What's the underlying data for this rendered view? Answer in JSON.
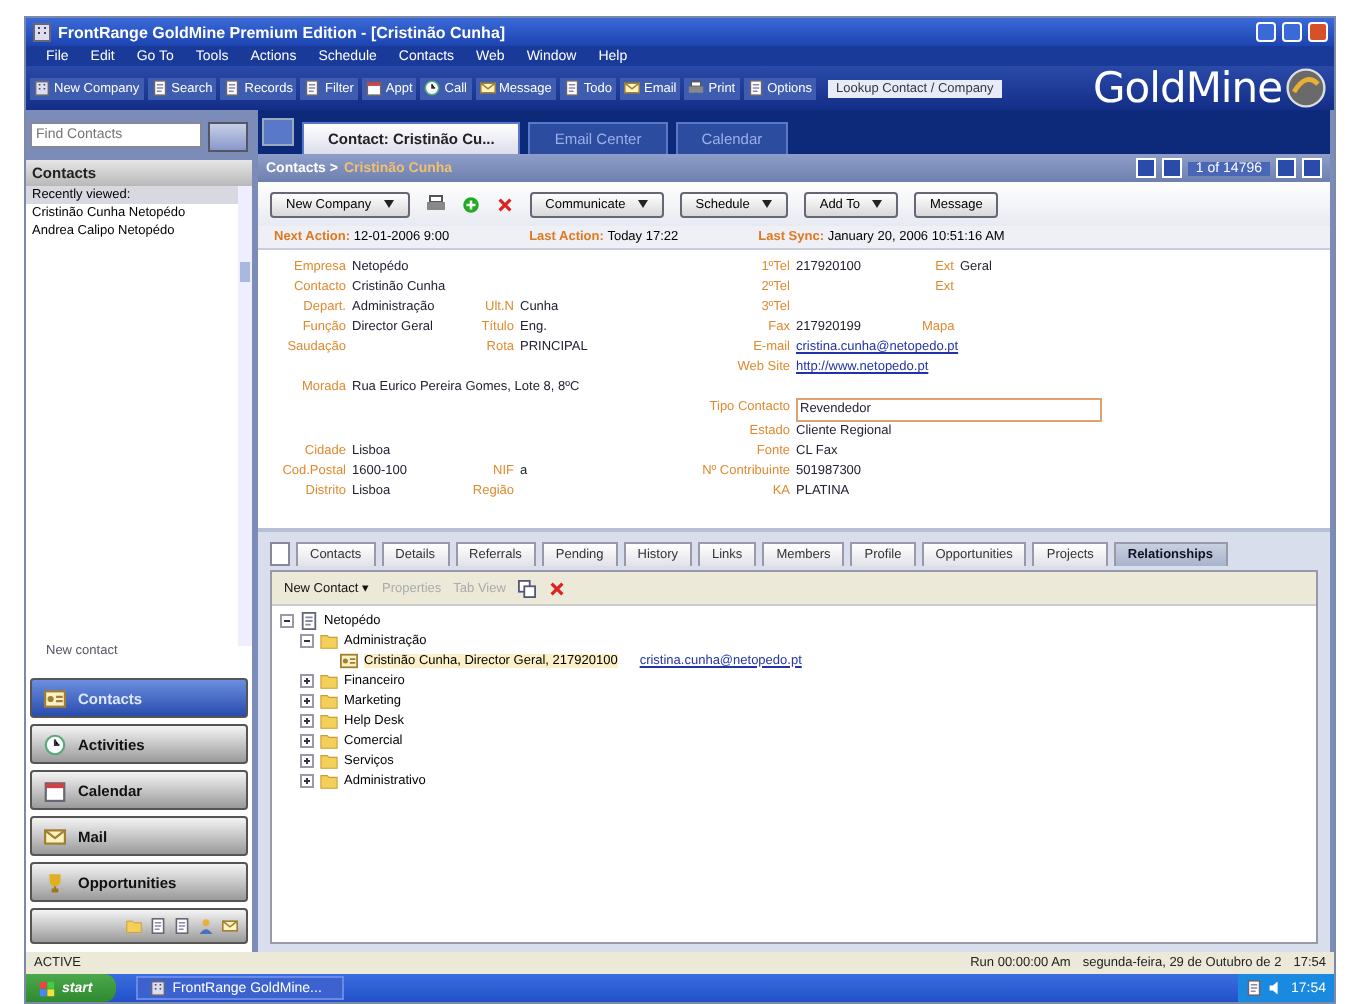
{
  "window": {
    "title": "FrontRange GoldMine Premium Edition - [Cristinão Cunha]"
  },
  "menu": [
    "File",
    "Edit",
    "Go To",
    "Tools",
    "Actions",
    "Schedule",
    "Contacts",
    "Web",
    "Window",
    "Help"
  ],
  "toolbar": {
    "items": [
      "New Company",
      "Search",
      "Records",
      "Filter",
      "Appt",
      "Call",
      "Message",
      "Todo",
      "Email",
      "Print",
      "Options"
    ],
    "lookup": "Lookup Contact / Company",
    "logo": "GoldMine"
  },
  "sidebar": {
    "search": {
      "placeholder": "Find Contacts"
    },
    "header": "Contacts",
    "recent_title": "Recently viewed:",
    "recent": [
      {
        "name": "Cristinão Cunha",
        "company": "Netopédo"
      },
      {
        "name": "Andrea Calipo",
        "company": "Netopédo"
      }
    ],
    "new_contact": "New contact",
    "nav": [
      {
        "label": "Contacts",
        "selected": true
      },
      {
        "label": "Activities",
        "selected": false
      },
      {
        "label": "Calendar",
        "selected": false
      },
      {
        "label": "Mail",
        "selected": false
      },
      {
        "label": "Opportunities",
        "selected": false
      }
    ]
  },
  "tabs": [
    {
      "label": "Contact: Cristinão Cu...",
      "selected": true
    },
    {
      "label": "Email Center",
      "selected": false
    },
    {
      "label": "Calendar",
      "selected": false
    }
  ],
  "breadcrumb": {
    "root": "Contacts >",
    "current": "Cristinão Cunha"
  },
  "record_count": "1 of 14796",
  "actions": [
    {
      "label": "New Company",
      "dropdown": true
    },
    {
      "kind": "icons"
    },
    {
      "label": "Communicate",
      "dropdown": true
    },
    {
      "label": "Schedule",
      "dropdown": true
    },
    {
      "label": "Add To",
      "dropdown": true
    },
    {
      "label": "Message",
      "dropdown": false
    }
  ],
  "activity": [
    {
      "label": "Next Action:",
      "value": "12-01-2006 9:00"
    },
    {
      "label": "Last Action:",
      "value": "Today 17:22"
    },
    {
      "label": "Last Sync:",
      "value": "January 20, 2006 10:51:16 AM"
    }
  ],
  "fields": [
    {
      "left": {
        "label": "Empresa",
        "value": "Netopédo"
      },
      "right": {
        "label": "1ºTel",
        "value": "217920100"
      },
      "extra": {
        "label": "Ext",
        "value": "Geral"
      }
    },
    {
      "left": {
        "label": "Contacto",
        "value": "Cristinão Cunha"
      },
      "right": {
        "label": "2ºTel"
      },
      "extra": {
        "label": "Ext"
      }
    },
    {
      "left": {
        "label": "Depart.",
        "value": "Administração"
      },
      "middle": {
        "label": "Ult.N",
        "value": "Cunha"
      },
      "right": {
        "label": "3ºTel"
      }
    },
    {
      "left": {
        "label": "Função",
        "value": "Director Geral"
      },
      "middle": {
        "label": "Título",
        "value": "Eng."
      },
      "right": {
        "label": "Fax",
        "value": "217920199"
      },
      "extra": {
        "label": "Mapa"
      }
    },
    {
      "left": {
        "label": "Saudação"
      },
      "middle": {
        "label": "Rota",
        "value": "PRINCIPAL"
      },
      "right": {
        "label": "E-mail",
        "value": "cristina.cunha@netopedo.pt",
        "kind": "link"
      }
    },
    {
      "right": {
        "label": "Web Site",
        "value": "http://www.netopedo.pt",
        "kind": "link"
      }
    },
    {
      "left": {
        "label": "Morada",
        "value": "Rua Eurico Pereira Gomes, Lote 8, 8ºC"
      }
    },
    {
      "right": {
        "label": "Tipo Contacto",
        "value": "Revendedor",
        "kind": "box"
      }
    },
    {
      "right": {
        "label": "Estado",
        "value": "Cliente Regional"
      }
    },
    {
      "left": {
        "label": "Cidade",
        "value": "Lisboa"
      },
      "right": {
        "label": "Fonte",
        "value": "CL Fax"
      }
    },
    {
      "left": {
        "label": "Cod.Postal",
        "value": "1600-100"
      },
      "middle": {
        "label": "NIF",
        "value": "a"
      },
      "right": {
        "label": "Nº Contribuinte",
        "value": "501987300"
      }
    },
    {
      "left": {
        "label": "Distrito",
        "value": "Lisboa"
      },
      "middle": {
        "label": "Região"
      },
      "right": {
        "label": "KA",
        "value": "PLATINA"
      }
    }
  ],
  "detail_tabs": [
    {
      "label": "Contacts",
      "selected": false
    },
    {
      "label": "Details",
      "selected": false
    },
    {
      "label": "Referrals",
      "selected": false
    },
    {
      "label": "Pending",
      "selected": false
    },
    {
      "label": "History",
      "selected": false
    },
    {
      "label": "Links",
      "selected": false
    },
    {
      "label": "Members",
      "selected": false
    },
    {
      "label": "Profile",
      "selected": false
    },
    {
      "label": "Opportunities",
      "selected": false
    },
    {
      "label": "Projects",
      "selected": false
    },
    {
      "label": "Relationships",
      "selected": true
    }
  ],
  "relationships": {
    "toolbar": [
      {
        "label": "New Contact ▾",
        "disabled": false
      },
      {
        "label": "Properties",
        "disabled": true
      },
      {
        "label": "Tab View",
        "disabled": true
      }
    ],
    "tree": [
      {
        "kind": "company",
        "label": "Netopédo",
        "expanded": true,
        "selected": false,
        "children": [
          {
            "kind": "folder",
            "label": "Administração",
            "expanded": true,
            "selected": false,
            "children": [
              {
                "kind": "contact",
                "label": "Cristinão Cunha, Director Geral, 217920100",
                "email": "cristina.cunha@netopedo.pt",
                "selected": true
              }
            ]
          },
          {
            "kind": "folder",
            "label": "Financeiro",
            "expanded": false,
            "selected": false
          },
          {
            "kind": "folder",
            "label": "Marketing",
            "expanded": false,
            "selected": false
          },
          {
            "kind": "folder",
            "label": "Help Desk",
            "expanded": false,
            "selected": false
          },
          {
            "kind": "folder",
            "label": "Comercial",
            "expanded": false,
            "selected": false
          },
          {
            "kind": "folder",
            "label": "Serviços",
            "expanded": false,
            "selected": false
          },
          {
            "kind": "folder",
            "label": "Administrativo",
            "expanded": false,
            "selected": false
          }
        ]
      }
    ]
  },
  "status_bar": {
    "left": "ACTIVE",
    "timer": "Run  00:00:00  Am",
    "date": "segunda-feira, 29 de Outubro de 2",
    "time": "17:54"
  },
  "taskbar": {
    "start": "start",
    "task": "FrontRange GoldMine...",
    "clock": "17:54"
  }
}
